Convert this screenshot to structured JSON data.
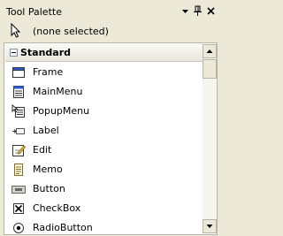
{
  "titlebar": {
    "title": "Tool Palette"
  },
  "selection": {
    "label": "(none selected)"
  },
  "category": {
    "label": "Standard"
  },
  "items": [
    {
      "label": "Frame",
      "icon": "frame-icon"
    },
    {
      "label": "MainMenu",
      "icon": "mainmenu-icon"
    },
    {
      "label": "PopupMenu",
      "icon": "popupmenu-icon"
    },
    {
      "label": "Label",
      "icon": "label-icon"
    },
    {
      "label": "Edit",
      "icon": "edit-icon"
    },
    {
      "label": "Memo",
      "icon": "memo-icon"
    },
    {
      "label": "Button",
      "icon": "button-icon"
    },
    {
      "label": "CheckBox",
      "icon": "checkbox-icon"
    },
    {
      "label": "RadioButton",
      "icon": "radiobutton-icon"
    }
  ]
}
